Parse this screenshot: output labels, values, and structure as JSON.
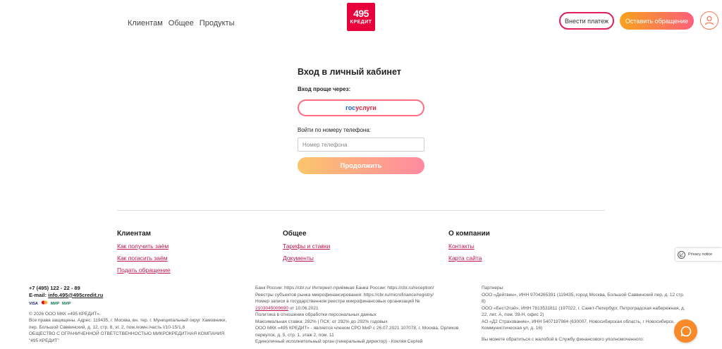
{
  "header": {
    "nav": [
      "Клиентам",
      "Общее",
      "Продукты"
    ],
    "logo": {
      "number": "495",
      "word": "КРЕДИТ"
    },
    "pay_button": "Внести платеж",
    "appeal_button": "Оставить обращение"
  },
  "login": {
    "title": "Вход в личный кабинет",
    "easy_label": "Вход проще через:",
    "gosuslugi": {
      "part1": "гос",
      "part2": "услуги"
    },
    "phone_label": "Войти по номеру телефона:",
    "phone_placeholder": "Номер телефона",
    "continue_button": "Продолжить"
  },
  "footer": {
    "columns": [
      {
        "title": "Клиентам",
        "links": [
          "Как получить заём",
          "Как погасить заём",
          "Подать обращение"
        ]
      },
      {
        "title": "Общее",
        "links": [
          "Тарифы и ставки",
          "Документы"
        ]
      },
      {
        "title": "О компании",
        "links": [
          "Контакты",
          "Карта сайта"
        ]
      }
    ],
    "privacy_notice": "Privacy notice",
    "contacts": {
      "phone": "+7 (495) 122 - 22 - 89",
      "email_label": "E-mail:",
      "email": "info.495@495credit.ru",
      "payment_icons": [
        "VISA",
        "MC",
        "МИР",
        "МИР"
      ],
      "copyright": "© 2026 ООО МКК «495 КРЕДИТ».",
      "rights": "Все права защищены. Адрес: 119435, г. Москва, вн. тер. г. Муниципальный округ Хамовники, пер. Большой Саввинский, д. 12, стр. 8, эт. 2, пом./комн./часть I/10-15/1,8",
      "company": "ОБЩЕСТВО С ОГРАНИЧЕННОЙ ОТВЕТСТВЕННОСТЬЮ МИКРОКРЕДИТНАЯ КОМПАНИЯ \"495 КРЕДИТ\""
    },
    "legal": {
      "line1": "Банк России: https://cbr.ru/ Интернет-приёмная Банка России:  https://cbr.ru/reception/",
      "line2": "Реестры субъектов рынка микрофинансирования: https://cbr.ru/microfinance/registry/",
      "line3": "Номер записи в государственном реестре микрофинансовых организаций №",
      "reg_number": "2103045009690",
      "reg_date": " от 10.06.2021",
      "line4": "Политика в отношении обработки персональных данных",
      "line5": "Максимальная ставка: 292% | ПСК: от 292% до 292% годовых",
      "line6": "ООО МКК «495 КРЕДИТ» - является членом СРО МиР с 26.07.2021 107078, г. Москва, Орликов переулок, д. 5, стр. 1, этаж 2, пом. 11",
      "line7": "Единоличный исполнительный орган (генеральный директор) - Кокляя Сергей"
    },
    "partners": {
      "title": "Партнеры:",
      "p1": "ООО «Дейтвин», ИНН 9704265391 (119435, город Москва, Большой Саввинский пер, д. 12 стр. 8)",
      "p2": "ООО «Бест2пэй», ИНН 7813531811 (197022, г. Санкт-Петербург, Петроградская набережная, д. 22, лит. А, пом. 39-Н, офис 2)",
      "p3": "АО «Д2 Страхование», ИНН 5407197984 (630007, Новосибирская область, г Новосибирск, Коммунистическая ул, д. 16)",
      "p4": "Вы можете обратиться с жалобой в Службу финансового уполномоченного:"
    }
  }
}
